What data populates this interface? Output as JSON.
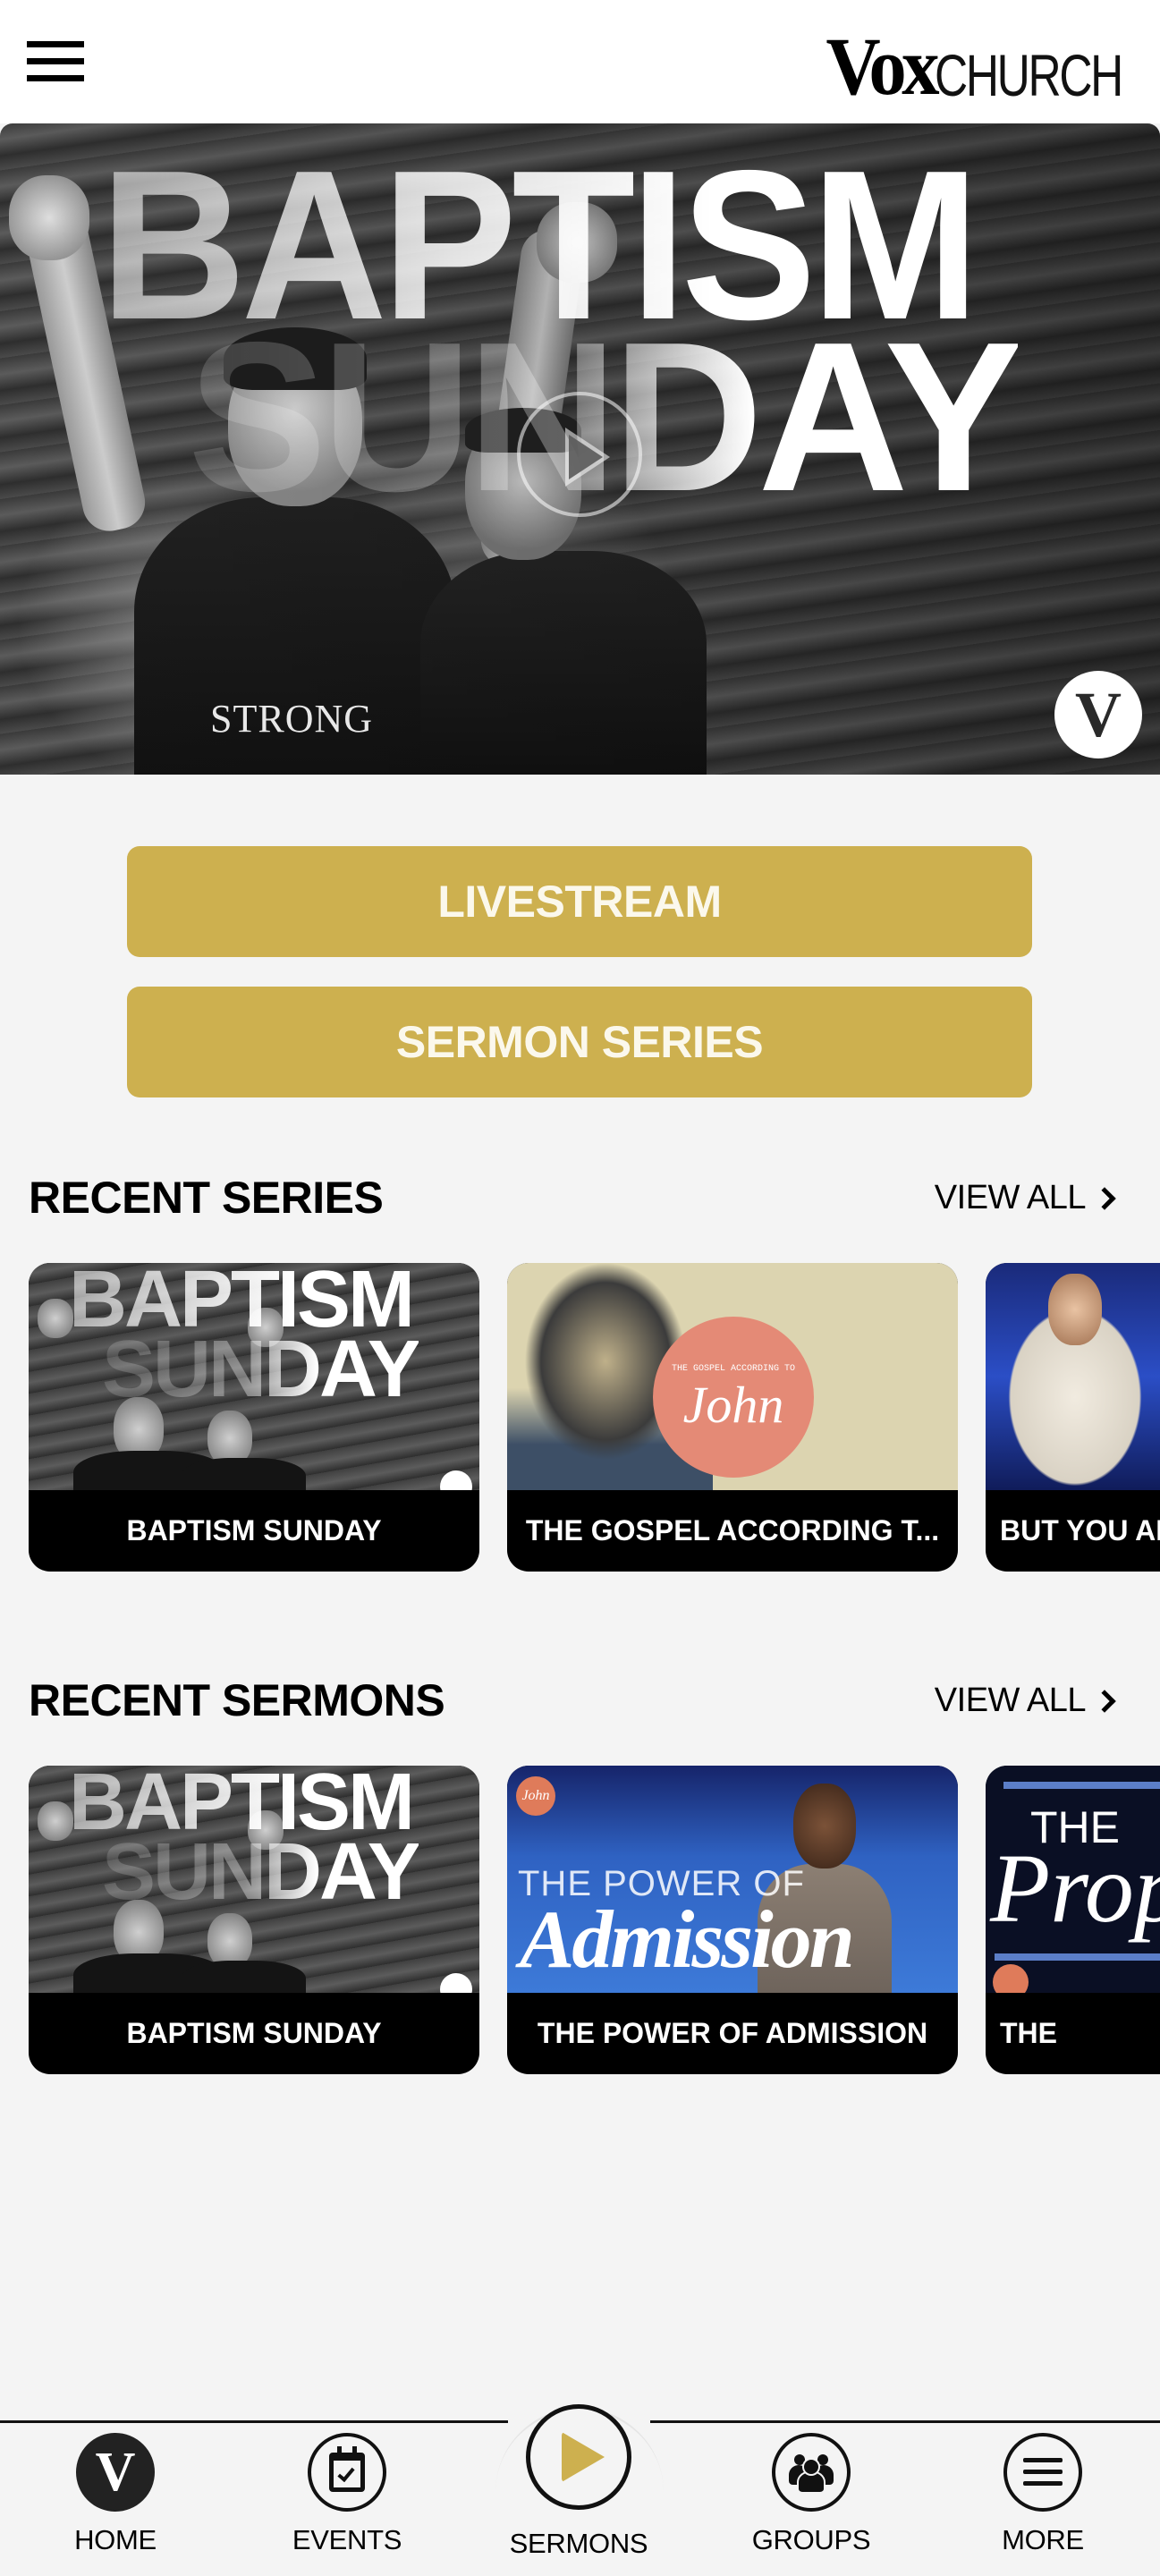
{
  "header": {
    "menu_icon": "hamburger-menu-icon",
    "logo_primary": "Vox",
    "logo_secondary": "CHURCH"
  },
  "hero": {
    "title_line_1": "BAPTISM",
    "title_line_2": "SUNDAY",
    "shirt_text": "STRONG",
    "play_icon": "play-circle-icon",
    "badge_letter": "V"
  },
  "buttons": {
    "livestream": "LIVESTREAM",
    "sermon_series": "SERMON SERIES"
  },
  "colors": {
    "accent_gold": "#cdb04f",
    "background": "#f4f4f4",
    "card_label_bg": "#000000"
  },
  "recent_series": {
    "title": "RECENT SERIES",
    "view_all": "VIEW ALL",
    "items": [
      {
        "label": "BAPTISM SUNDAY",
        "thumb_line_1": "BAPTISM",
        "thumb_line_2": "SUNDAY"
      },
      {
        "label": "THE GOSPEL ACCORDING T...",
        "thumb_small": "THE GOSPEL ACCORDING TO",
        "thumb_big": "John"
      },
      {
        "label": "BUT YOU AI"
      }
    ]
  },
  "recent_sermons": {
    "title": "RECENT SERMONS",
    "view_all": "VIEW ALL",
    "items": [
      {
        "label": "BAPTISM SUNDAY",
        "thumb_line_1": "BAPTISM",
        "thumb_line_2": "SUNDAY"
      },
      {
        "label": "THE POWER OF ADMISSION",
        "thumb_line_1": "THE POWER OF",
        "thumb_line_2": "Admission",
        "badge": "John"
      },
      {
        "label": "THE",
        "thumb_line_1": "THE",
        "thumb_line_2": "Prop"
      }
    ]
  },
  "bottom_nav": {
    "items": [
      {
        "label": "HOME",
        "icon": "V"
      },
      {
        "label": "EVENTS",
        "icon": "calendar-check-icon"
      },
      {
        "label": "SERMONS",
        "icon": "play-icon",
        "active": true
      },
      {
        "label": "GROUPS",
        "icon": "group-icon"
      },
      {
        "label": "MORE",
        "icon": "menu-icon"
      }
    ]
  }
}
